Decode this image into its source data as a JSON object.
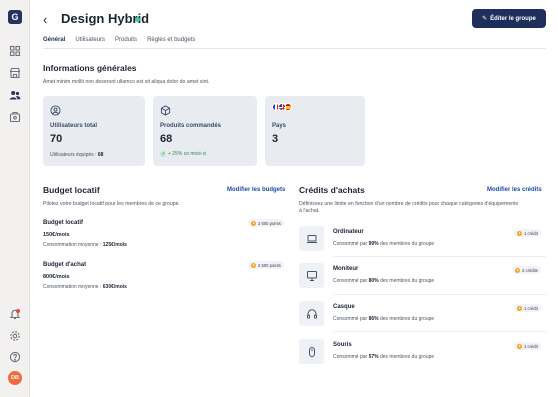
{
  "app": {
    "logo": "G",
    "avatar_initials": "DB"
  },
  "sidebar": {
    "items": [
      {
        "icon": "grid-icon",
        "active": false
      },
      {
        "icon": "store-icon",
        "active": false
      },
      {
        "icon": "users-icon",
        "active": true
      },
      {
        "icon": "box-icon",
        "active": false
      }
    ],
    "bottom": [
      {
        "icon": "bell-icon"
      },
      {
        "icon": "gear-icon"
      },
      {
        "icon": "help-icon"
      }
    ]
  },
  "header": {
    "title": "Design Hybrid",
    "edit_button": "Éditer le groupe",
    "status_color": "#3ecf8e"
  },
  "tabs": [
    {
      "label": "Général",
      "active": true
    },
    {
      "label": "Utilisateurs",
      "active": false
    },
    {
      "label": "Produits",
      "active": false
    },
    {
      "label": "Règles et budgets",
      "active": false
    }
  ],
  "general": {
    "heading": "Informations générales",
    "description": "Amet minim mollit non deserunt ullamco est sit aliqua dolor do amet sint.",
    "cards": {
      "users": {
        "label": "Utilisateurs total",
        "value": "70",
        "sub_label": "Utilisateurs équipés : ",
        "sub_value": "68"
      },
      "products": {
        "label": "Produits commandés",
        "value": "68",
        "trend": "+ 25% ce mois-ci"
      },
      "countries": {
        "label": "Pays",
        "value": "3",
        "flags": [
          "FR",
          "GB",
          "ES"
        ]
      }
    }
  },
  "budget": {
    "heading": "Budget locatif",
    "edit_link": "Modifier les budgets",
    "description": "Pilotez votre budget locatif pour les membres de ce groupe.",
    "items": [
      {
        "title": "Budget locatif",
        "amount": "150€/mois",
        "consumption_label": "Consommation moyenne : ",
        "consumption_value": "125€/mois",
        "points": "2 500 points"
      },
      {
        "title": "Budget d'achat",
        "amount": "800€/mois",
        "consumption_label": "Consommation moyenne : ",
        "consumption_value": "630€/mois",
        "points": "2 500 points"
      }
    ]
  },
  "credits": {
    "heading": "Crédits d'achats",
    "edit_link": "Modifier les crédits",
    "description_line1": "Définissez une limite en fonction d'un nombre de crédits pour chaque catégories d'équipements",
    "description_line2": "à l'achat.",
    "items": [
      {
        "name": "Ordinateur",
        "icon": "laptop-icon",
        "pre": "Consommé par ",
        "pct": "99%",
        "post": " des membres du groupe",
        "credits": "1 crédit"
      },
      {
        "name": "Moniteur",
        "icon": "monitor-icon",
        "pre": "Consommé par ",
        "pct": "80%",
        "post": " des membres du groupe",
        "credits": "2 crédits"
      },
      {
        "name": "Casque",
        "icon": "headphones-icon",
        "pre": "Consommé par ",
        "pct": "86%",
        "post": " des membres du groupe",
        "credits": "1 crédit"
      },
      {
        "name": "Souris",
        "icon": "mouse-icon",
        "pre": "Consommé par ",
        "pct": "57%",
        "post": " des membres du groupe",
        "credits": "1 crédit"
      }
    ]
  }
}
